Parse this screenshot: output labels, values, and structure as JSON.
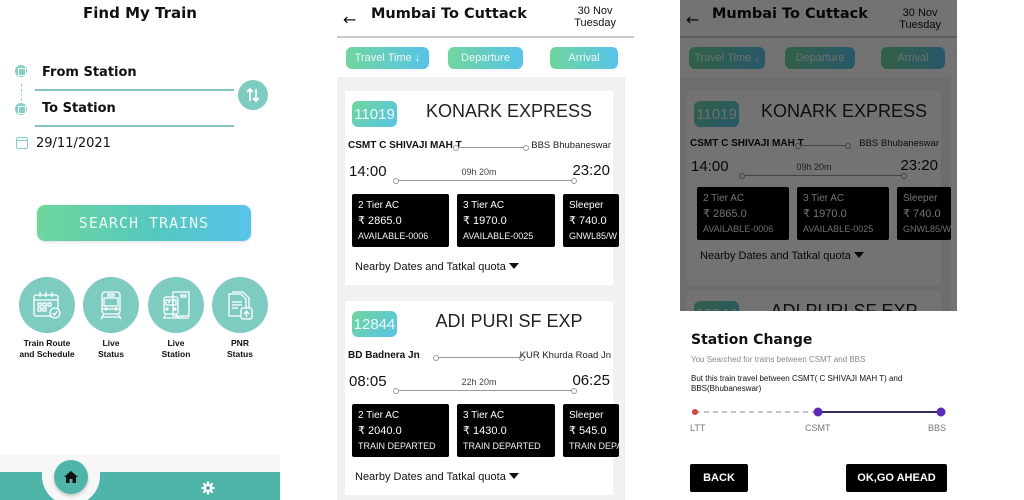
{
  "find_train": {
    "title": "Find My Train",
    "from_placeholder": "From Station",
    "to_placeholder": "To Station",
    "date": "29/11/2021",
    "search_label": "SEARCH TRAINS",
    "quick_links": [
      {
        "label": "Train Route\nand Schedule",
        "icon": "calendar-check-icon"
      },
      {
        "label": "Live\nStatus",
        "icon": "train-front-icon"
      },
      {
        "label": "Live\nStation",
        "icon": "station-icon"
      },
      {
        "label": "PNR\nStatus",
        "icon": "document-upload-icon"
      }
    ],
    "nav": {
      "home": "home-icon",
      "settings": "gear-icon"
    }
  },
  "results": {
    "title": "Mumbai To Cuttack",
    "date_line1": "30 Nov",
    "date_line2": "Tuesday",
    "sort_buttons": [
      "Travel Time ↓",
      "Departure",
      "Arrival"
    ],
    "nearby_label": "Nearby Dates and Tatkal quota",
    "trains": [
      {
        "number": "11019",
        "name": "KONARK EXPRESS",
        "from": "CSMT C SHIVAJI MAH T",
        "to": "BBS Bhubaneswar",
        "departure": "14:00",
        "arrival": "23:20",
        "duration": "09h 20m",
        "classes": [
          {
            "name": "2 Tier AC",
            "price": "₹ 2865.0",
            "status": "AVAILABLE-0006"
          },
          {
            "name": "3 Tier AC",
            "price": "₹ 1970.0",
            "status": "AVAILABLE-0025"
          },
          {
            "name": "Sleeper",
            "price": "₹ 740.0",
            "status": "GNWL85/W"
          }
        ]
      },
      {
        "number": "12844",
        "name": "ADI PURI SF EXP",
        "from": "BD Badnera Jn",
        "to": "KUR Khurda Road Jn",
        "departure": "08:05",
        "arrival": "06:25",
        "duration": "22h 20m",
        "classes": [
          {
            "name": "2 Tier AC",
            "price": "₹ 2040.0",
            "status": "TRAIN DEPARTED"
          },
          {
            "name": "3 Tier AC",
            "price": "₹ 1430.0",
            "status": "TRAIN DEPARTED"
          },
          {
            "name": "Sleeper",
            "price": "₹ 545.0",
            "status": "TRAIN DEPA"
          }
        ]
      }
    ]
  },
  "station_change": {
    "title": "Station Change",
    "subtitle": "You Searched for trains between CSMT and BBS",
    "body": "But this train travel between CSMT( C SHIVAJI MAH T) and BBS(Bhubaneswar)",
    "stations": [
      "LTT",
      "CSMT",
      "BBS"
    ],
    "back_label": "BACK",
    "ok_label": "OK,GO AHEAD",
    "colors": {
      "origin": "#d0463a",
      "route": "#5b2bb5",
      "track": "#3a2a5c"
    }
  }
}
